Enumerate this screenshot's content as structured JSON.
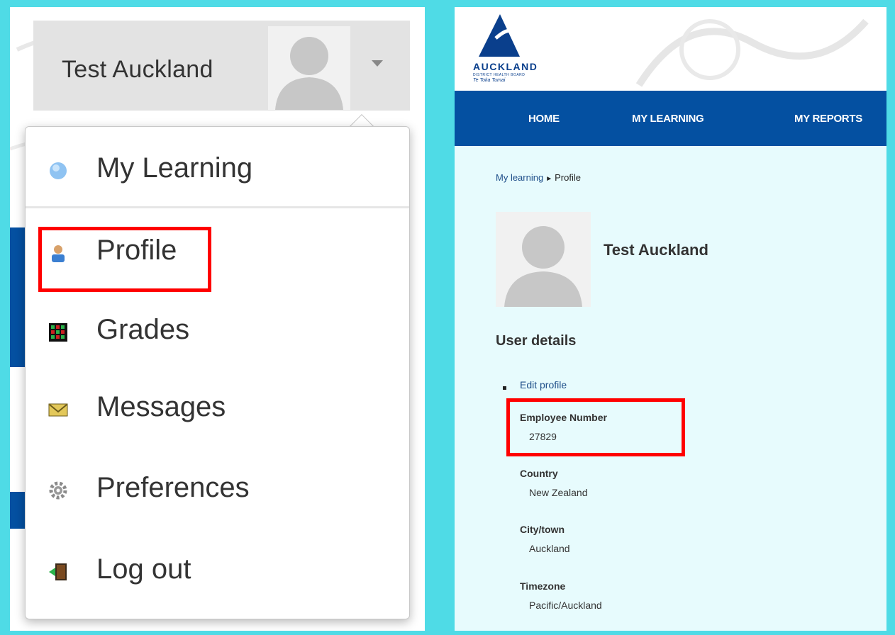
{
  "user_menu": {
    "user_name": "Test Auckland",
    "items": [
      {
        "label": "My Learning",
        "icon": "cube-icon"
      },
      {
        "label": "Profile",
        "icon": "user-icon"
      },
      {
        "label": "Grades",
        "icon": "grades-grid-icon"
      },
      {
        "label": "Messages",
        "icon": "envelope-icon"
      },
      {
        "label": "Preferences",
        "icon": "gear-icon"
      },
      {
        "label": "Log out",
        "icon": "door-exit-icon"
      }
    ]
  },
  "site": {
    "logo_text": "AUCKLAND",
    "logo_subtext": "DISTRICT HEALTH BOARD",
    "logo_tagline": "Te Toka Tumai",
    "nav": [
      "HOME",
      "MY LEARNING",
      "MY REPORTS"
    ]
  },
  "profile": {
    "breadcrumb": {
      "parent": "My learning",
      "current": "Profile"
    },
    "name": "Test Auckland",
    "section_title": "User details",
    "edit_link": "Edit profile",
    "fields": [
      {
        "label": "Employee Number",
        "value": "27829"
      },
      {
        "label": "Country",
        "value": "New Zealand"
      },
      {
        "label": "City/town",
        "value": "Auckland"
      },
      {
        "label": "Timezone",
        "value": "Pacific/Auckland"
      }
    ]
  },
  "colors": {
    "background": "#4fdbe6",
    "navbar": "#0450a1",
    "highlight": "#ff0000",
    "link": "#1f4f8a"
  }
}
